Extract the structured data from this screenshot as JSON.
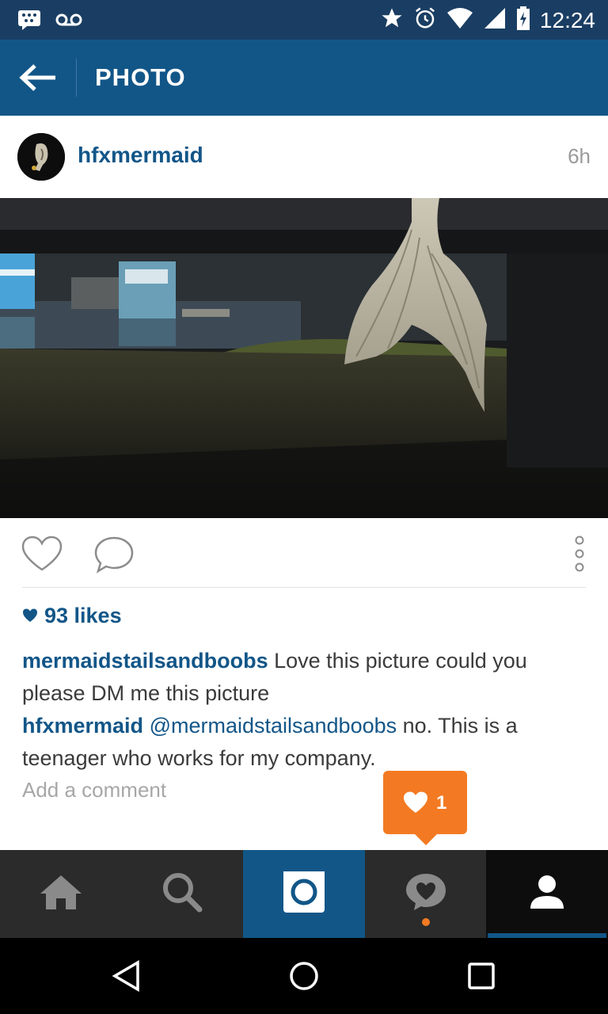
{
  "status_bar": {
    "time": "12:24",
    "left_icons": [
      "bbm-icon",
      "voicemail-icon"
    ],
    "right_icons": [
      "star-icon",
      "alarm-icon",
      "wifi-icon",
      "signal-icon",
      "battery-icon"
    ]
  },
  "app_bar": {
    "title": "PHOTO",
    "back_icon": "arrow-left-icon"
  },
  "post": {
    "username": "hfxmermaid",
    "time_ago": "6h",
    "likes_text": "93 likes",
    "comments": [
      {
        "user": "mermaidstailsandboobs",
        "text": " Love this picture could you please DM me this picture"
      },
      {
        "user": "hfxmermaid",
        "mention": " @mermaidstailsandboobs",
        "text": " no. This is a teenager who works for my company."
      }
    ],
    "add_comment_placeholder": "Add a comment"
  },
  "notification": {
    "count": "1",
    "icon": "heart-icon"
  },
  "tab_bar": {
    "tabs": [
      {
        "name": "home",
        "icon": "home-icon"
      },
      {
        "name": "search",
        "icon": "search-icon"
      },
      {
        "name": "camera",
        "icon": "camera-icon",
        "selected": true
      },
      {
        "name": "activity",
        "icon": "activity-heart-bubble-icon",
        "has_dot": true
      },
      {
        "name": "profile",
        "icon": "profile-icon"
      }
    ]
  },
  "colors": {
    "status_bar": "#1a3e63",
    "app_bar": "#125688",
    "link_blue": "#125688",
    "notification_orange": "#f37a22",
    "tab_bar": "#2b2b2b"
  }
}
